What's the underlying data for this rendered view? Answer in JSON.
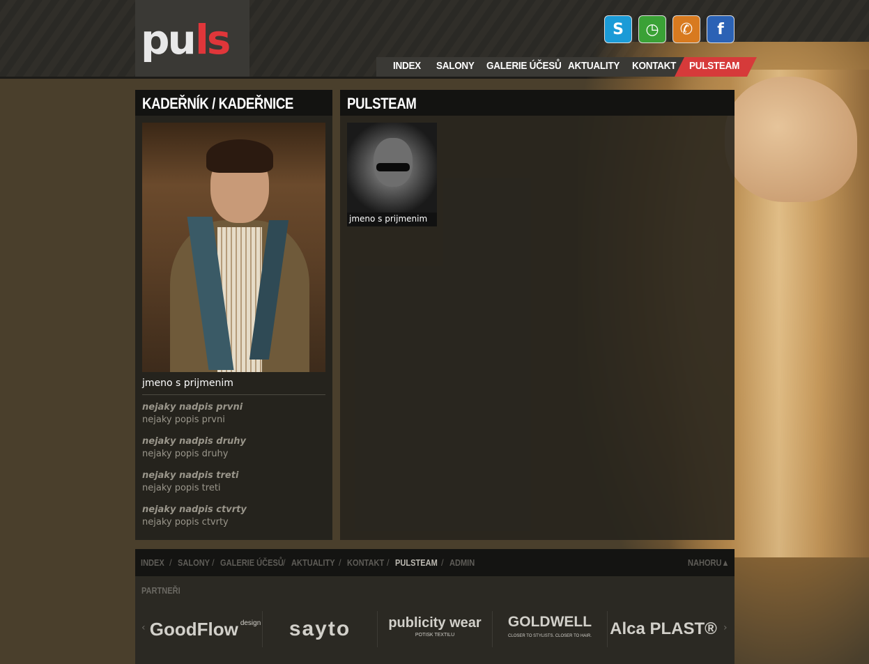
{
  "brand": {
    "logo_part1": "pu",
    "logo_part2": "ls",
    "accent": "#d63a3a"
  },
  "social": [
    {
      "icon": "skype-icon",
      "glyph": "S",
      "color": "#1b9bd7"
    },
    {
      "icon": "clock-icon",
      "glyph": "◷",
      "color": "#3aa136"
    },
    {
      "icon": "phone-icon",
      "glyph": "✆",
      "color": "#d87a1f"
    },
    {
      "icon": "facebook-icon",
      "glyph": "f",
      "color": "#2b62b5"
    }
  ],
  "nav": [
    "INDEX",
    "SALONY",
    "GALERIE ÚČESŮ",
    "AKTUALITY",
    "KONTAKT",
    "PULSTEAM"
  ],
  "left_panel": {
    "title": "KADEŘNÍK / KADEŘNICE",
    "name": "jmeno s prijmenim",
    "items": [
      {
        "heading": "nejaky nadpis prvni",
        "desc": "nejaky popis prvni"
      },
      {
        "heading": "nejaky nadpis druhy",
        "desc": "nejaky popis druhy"
      },
      {
        "heading": "nejaky nadpis treti",
        "desc": "nejaky popis treti"
      },
      {
        "heading": "nejaky nadpis ctvrty",
        "desc": "nejaky popis ctvrty"
      }
    ]
  },
  "right_panel": {
    "title": "PULSTEAM",
    "thumb_caption": "jmeno s prijmenim"
  },
  "footer": {
    "links": [
      "INDEX",
      "SALONY",
      "GALERIE ÚČESŮ",
      "AKTUALITY",
      "KONTAKT",
      "PULSTEAM",
      "ADMIN"
    ],
    "separator": "/",
    "top_link": "NAHORU▲",
    "partners_label": "PARTNEŘI",
    "partners": [
      {
        "name": "GoodFlow",
        "sub": "design"
      },
      {
        "name": "sayto",
        "sub": ""
      },
      {
        "name": "publicity wear",
        "sub": "POTISK TEXTILU"
      },
      {
        "name": "GOLDWELL",
        "sub": "CLOSER TO STYLISTS. CLOSER TO HAIR."
      },
      {
        "name": "Alca PLAST®",
        "sub": ""
      }
    ],
    "arrow_left": "‹",
    "arrow_right": "›"
  }
}
